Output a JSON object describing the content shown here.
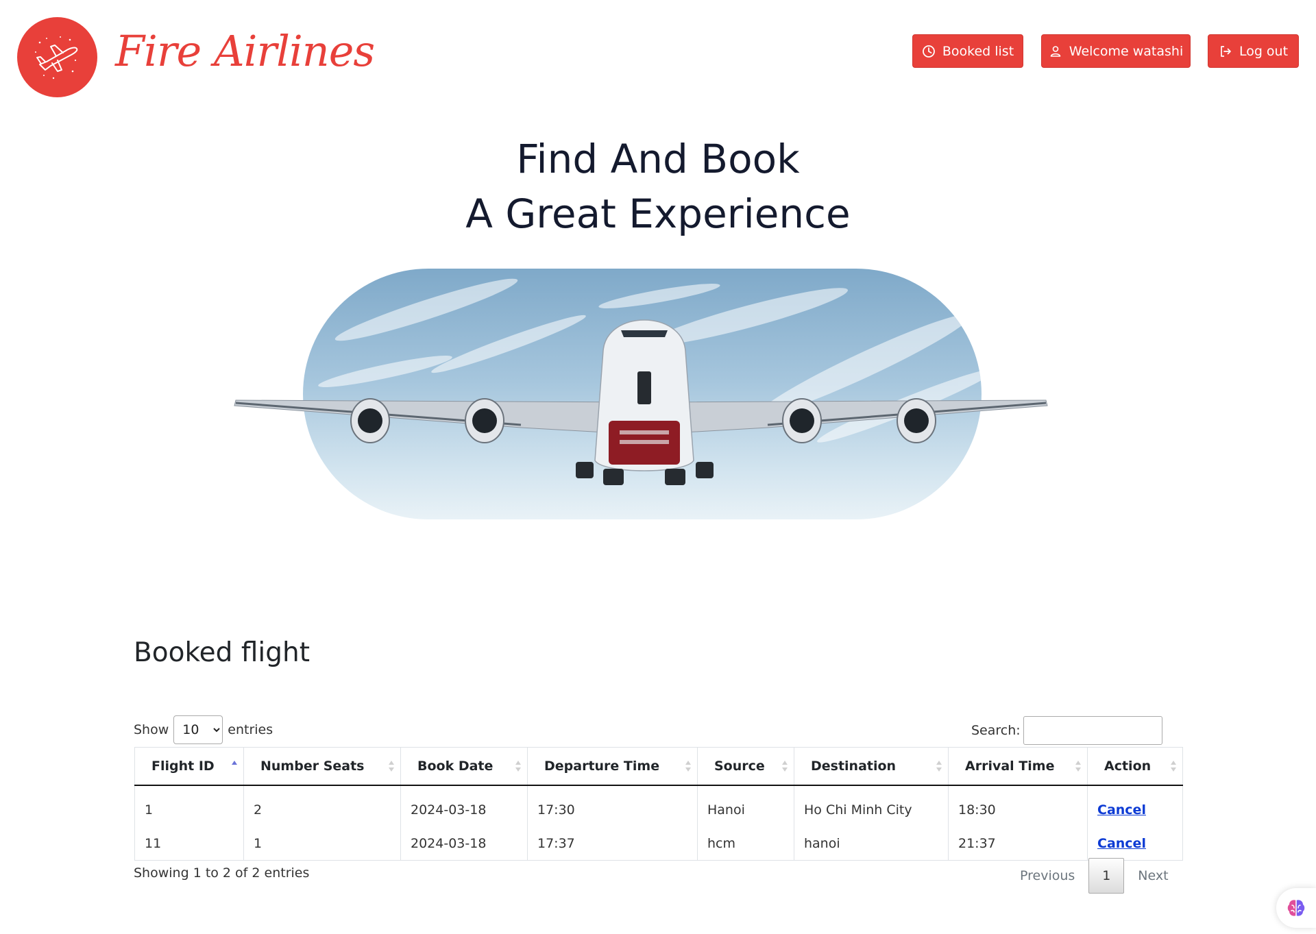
{
  "brand": {
    "name": "Fire Airlines",
    "logo_icon": "airplane-icon",
    "color": "#e8403a"
  },
  "nav": {
    "booked_list": "Booked list",
    "welcome": "Welcome watashi",
    "logout": "Log out"
  },
  "hero": {
    "line1": "Find And Book",
    "line2": "A Great Experience"
  },
  "booked": {
    "title": "Booked flight",
    "show_label": "Show",
    "entries_label": "entries",
    "page_size": "10",
    "search_label": "Search:",
    "search_value": "",
    "columns": [
      "Flight ID",
      "Number Seats",
      "Book Date",
      "Departure Time",
      "Source",
      "Destination",
      "Arrival Time",
      "Action"
    ],
    "rows": [
      {
        "flight_id": "1",
        "seats": "2",
        "book_date": "2024-03-18",
        "departure": "17:30",
        "source": "Hanoi",
        "destination": "Ho Chi Minh City",
        "arrival": "18:30",
        "action": "Cancel"
      },
      {
        "flight_id": "11",
        "seats": "1",
        "book_date": "2024-03-18",
        "departure": "17:37",
        "source": "hcm",
        "destination": "hanoi",
        "arrival": "21:37",
        "action": "Cancel"
      }
    ],
    "info": "Showing 1 to 2 of 2 entries",
    "pagination": {
      "previous": "Previous",
      "current": "1",
      "next": "Next"
    }
  }
}
